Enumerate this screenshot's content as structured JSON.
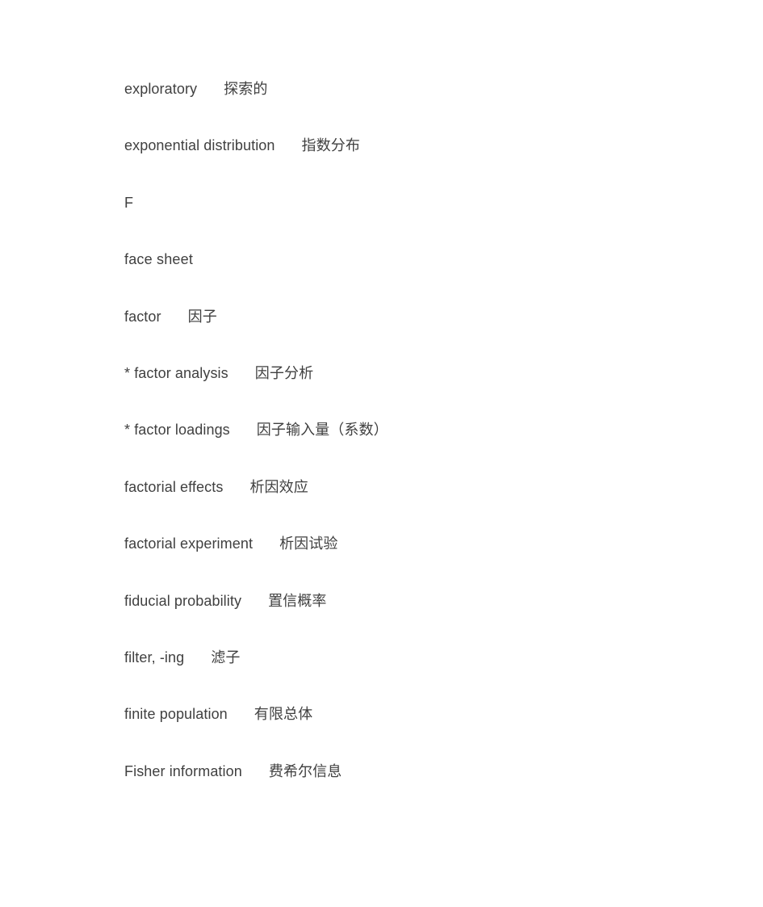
{
  "document": {
    "background_color": "#ffffff",
    "text_color": "#404040",
    "section_letter": "F",
    "entries": [
      {
        "term": "exploratory",
        "gloss": "探索的"
      },
      {
        "term": "exponential distribution",
        "gloss": "指数分布"
      },
      {
        "term": "F",
        "gloss": ""
      },
      {
        "term": "face sheet",
        "gloss": ""
      },
      {
        "term": "factor",
        "gloss": "因子"
      },
      {
        "term": "* factor analysis",
        "gloss": "因子分析"
      },
      {
        "term": "* factor loadings",
        "gloss": "因子输入量（系数）"
      },
      {
        "term": "factorial effects",
        "gloss": "析因效应"
      },
      {
        "term": "factorial experiment",
        "gloss": "析因试验"
      },
      {
        "term": "fiducial probability",
        "gloss": "置信概率"
      },
      {
        "term": "filter, -ing",
        "gloss": "滤子"
      },
      {
        "term": "finite population",
        "gloss": "有限总体"
      },
      {
        "term": "Fisher information",
        "gloss": "费希尔信息"
      }
    ]
  }
}
